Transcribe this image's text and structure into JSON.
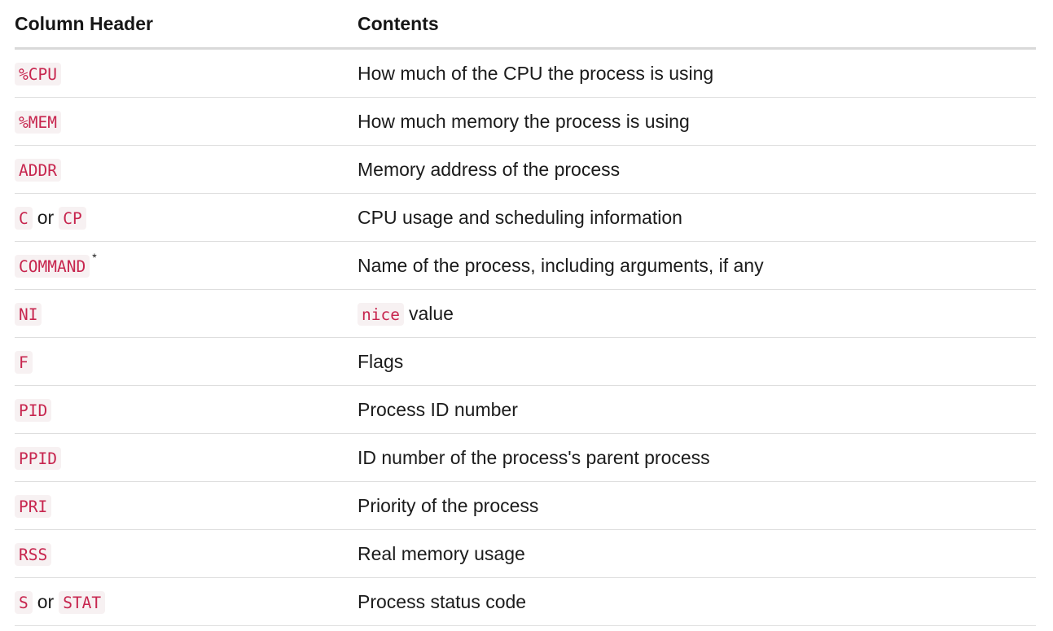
{
  "table": {
    "headers": [
      "Column Header",
      "Contents"
    ],
    "rows": [
      {
        "tokens": [
          "%CPU"
        ],
        "connector": "",
        "footnote": "",
        "desc_code": "",
        "desc": "How much of the CPU the process is using"
      },
      {
        "tokens": [
          "%MEM"
        ],
        "connector": "",
        "footnote": "",
        "desc_code": "",
        "desc": "How much memory the process is using"
      },
      {
        "tokens": [
          "ADDR"
        ],
        "connector": "",
        "footnote": "",
        "desc_code": "",
        "desc": "Memory address of the process"
      },
      {
        "tokens": [
          "C",
          "CP"
        ],
        "connector": "or",
        "footnote": "",
        "desc_code": "",
        "desc": "CPU usage and scheduling information"
      },
      {
        "tokens": [
          "COMMAND"
        ],
        "connector": "",
        "footnote": "*",
        "desc_code": "",
        "desc": "Name of the process, including arguments, if any"
      },
      {
        "tokens": [
          "NI"
        ],
        "connector": "",
        "footnote": "",
        "desc_code": "nice",
        "desc": "value"
      },
      {
        "tokens": [
          "F"
        ],
        "connector": "",
        "footnote": "",
        "desc_code": "",
        "desc": "Flags"
      },
      {
        "tokens": [
          "PID"
        ],
        "connector": "",
        "footnote": "",
        "desc_code": "",
        "desc": "Process ID number"
      },
      {
        "tokens": [
          "PPID"
        ],
        "connector": "",
        "footnote": "",
        "desc_code": "",
        "desc": "ID number of the process's parent process"
      },
      {
        "tokens": [
          "PRI"
        ],
        "connector": "",
        "footnote": "",
        "desc_code": "",
        "desc": "Priority of the process"
      },
      {
        "tokens": [
          "RSS"
        ],
        "connector": "",
        "footnote": "",
        "desc_code": "",
        "desc": "Real memory usage"
      },
      {
        "tokens": [
          "S",
          "STAT"
        ],
        "connector": "or",
        "footnote": "",
        "desc_code": "",
        "desc": "Process status code"
      }
    ]
  }
}
